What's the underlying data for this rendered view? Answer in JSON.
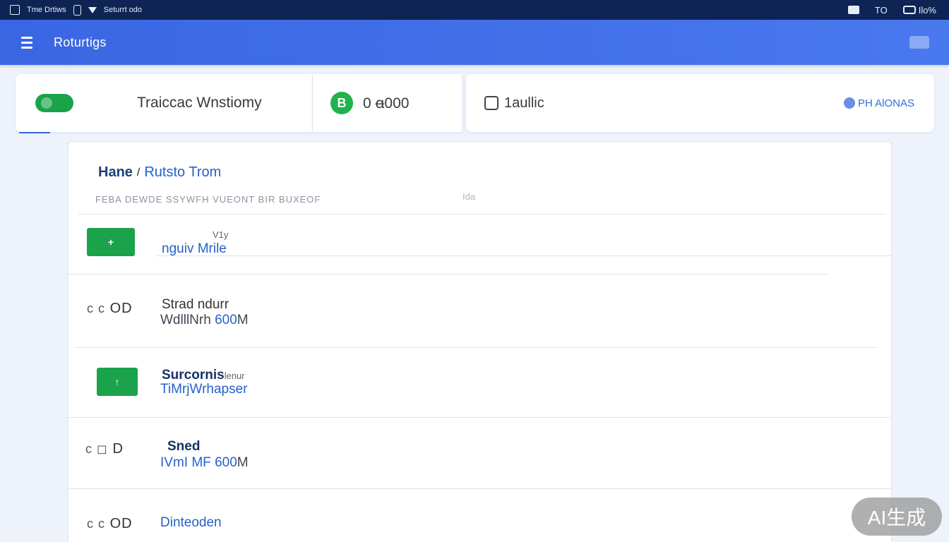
{
  "status_bar": {
    "left_a": "Tme Drtiws",
    "left_b": "Seturrt odo",
    "right_a": "TO",
    "right_b": "Ilo%"
  },
  "app_bar": {
    "title": "Roturtigs"
  },
  "cards": {
    "card1_label": "Traiccac Wnstiomy",
    "card2_symbol": "B",
    "card2_value": "0 ꬰ000",
    "card3_label": "1aullic",
    "card3_right": "PH AlONAS"
  },
  "breadcrumb": {
    "home": "Hane",
    "separator": "/",
    "current": "Rutsto Trom"
  },
  "table_header": {
    "col1": "FEBA DEWDE SSYWFH VUEONT BIR BUXEOF",
    "col2": "Ida"
  },
  "rows": [
    {
      "badge": "+",
      "small": "V1y",
      "title": "",
      "sub": "nguiv Mrile"
    },
    {
      "code_pre": "c c",
      "code": "OD",
      "title": "Strad ndurr",
      "sub_a": "WdlllNrh",
      "sub_b": "600",
      "sub_c": "M"
    },
    {
      "badge": "↑",
      "title": "Surcornis",
      "title_b": "lenur",
      "sub": "TiMrjWrhapser"
    },
    {
      "code_pre": "c ◻",
      "code": "D",
      "title": "Sned",
      "sub_a": "IVmI MF",
      "sub_b": "600",
      "sub_c": "M"
    },
    {
      "code_pre": "c c",
      "code": "OD",
      "title": "Dinteoden"
    }
  ],
  "watermark": "AI生成",
  "colors": {
    "status_bar": "#0e2454",
    "app_bar": "#3a66e3",
    "accent_green": "#1aa34a",
    "link_blue": "#2561c9"
  }
}
